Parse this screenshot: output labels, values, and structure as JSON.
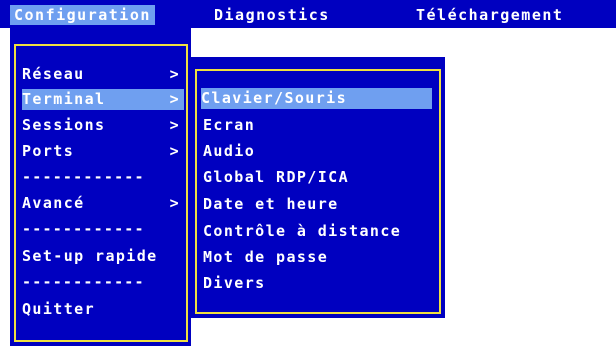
{
  "menubar": {
    "items": [
      {
        "label": "Configuration"
      },
      {
        "label": "Diagnostics"
      },
      {
        "label": "Téléchargement"
      }
    ]
  },
  "main_menu": {
    "items": [
      {
        "label": "Réseau",
        "arrow": ">"
      },
      {
        "label": "Terminal",
        "arrow": ">"
      },
      {
        "label": "Sessions",
        "arrow": ">"
      },
      {
        "label": "Ports",
        "arrow": ">"
      },
      {
        "label": "Avancé",
        "arrow": ">"
      },
      {
        "label": "Set-up rapide"
      },
      {
        "label": "Quitter"
      }
    ],
    "separator": "------------"
  },
  "submenu": {
    "items": [
      {
        "label": "Clavier/Souris"
      },
      {
        "label": "Ecran"
      },
      {
        "label": "Audio"
      },
      {
        "label": "Global RDP/ICA"
      },
      {
        "label": "Date et heure"
      },
      {
        "label": "Contrôle à distance"
      },
      {
        "label": "Mot de passe"
      },
      {
        "label": "Divers"
      }
    ]
  },
  "colors": {
    "menu_blue": "#0000c0",
    "highlight": "#6f9ff0",
    "frame_yellow": "#f0e040",
    "text": "#ffffff"
  }
}
